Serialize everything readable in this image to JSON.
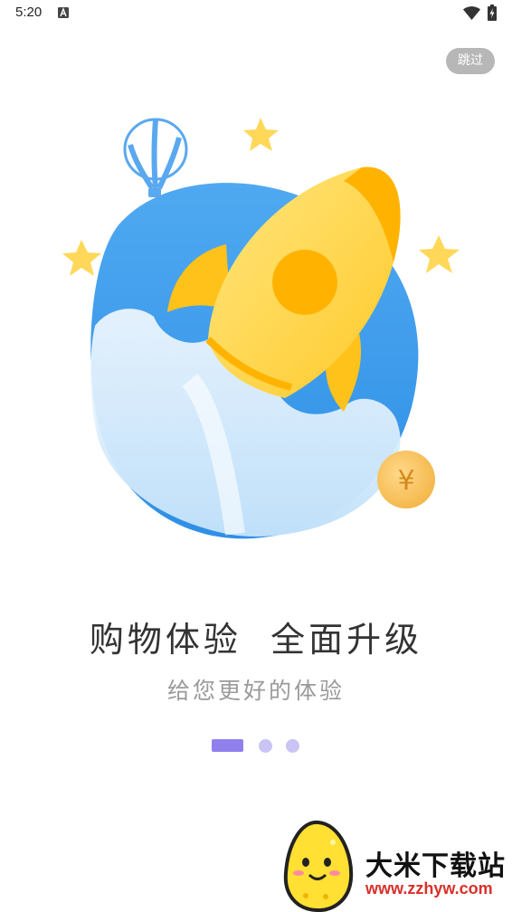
{
  "status_bar": {
    "time": "5:20",
    "icons": [
      "a-notification-icon",
      "wifi-icon",
      "battery-icon"
    ]
  },
  "skip_button": {
    "label": "跳过"
  },
  "onboarding": {
    "headline": "购物体验  全面升级",
    "subtitle": "给您更好的体验",
    "page_count": 3,
    "current_page": 1
  },
  "illustration": {
    "coin_symbol": "¥",
    "colors": {
      "sky_blue": "#4aa6f0",
      "rocket_yellow": "#ffd53d",
      "rocket_orange": "#ffb300",
      "coin": "#f9c25a",
      "star": "#ffd85a"
    }
  },
  "watermark": {
    "title": "大米下载站",
    "url": "www.zzhyw.com"
  },
  "colors": {
    "indicator_active": "#8f80ee",
    "indicator_inactive": "#c9c4f4",
    "skip_bg": "#b7b7b7"
  }
}
